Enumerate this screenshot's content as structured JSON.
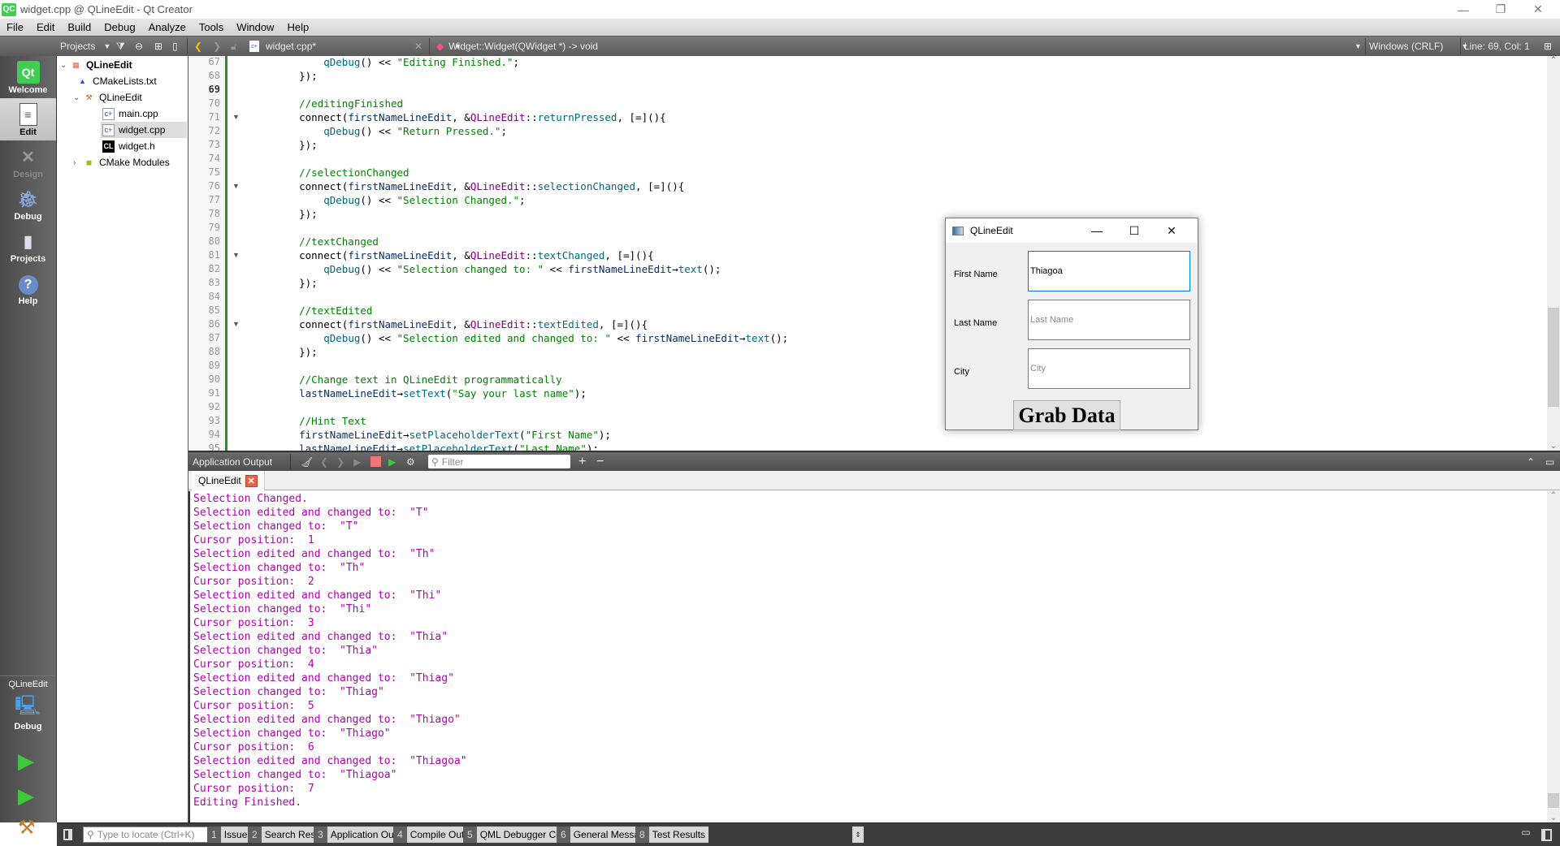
{
  "window": {
    "title": "widget.cpp @ QLineEdit - Qt Creator",
    "app_icon": "QC"
  },
  "menu": [
    "File",
    "Edit",
    "Build",
    "Debug",
    "Analyze",
    "Tools",
    "Window",
    "Help"
  ],
  "toolbar": {
    "projects_label": "Projects",
    "file_tab": "widget.cpp*",
    "symbol": "Widget::Widget(QWidget *) -> void",
    "line_ending": "Windows (CRLF)",
    "cursor_pos": "Line: 69, Col: 1"
  },
  "modes": [
    {
      "label": "Welcome",
      "icon": "qt-logo-icon"
    },
    {
      "label": "Edit",
      "icon": "edit-document-icon"
    },
    {
      "label": "Design",
      "icon": "design-tools-icon"
    },
    {
      "label": "Debug",
      "icon": "bug-icon"
    },
    {
      "label": "Projects",
      "icon": "folder-icon"
    },
    {
      "label": "Help",
      "icon": "help-icon"
    }
  ],
  "kit": {
    "project": "QLineEdit",
    "config": "Debug"
  },
  "tree": [
    {
      "label": "QLineEdit",
      "bold": true
    },
    {
      "label": "CMakeLists.txt"
    },
    {
      "label": "QLineEdit"
    },
    {
      "label": "main.cpp"
    },
    {
      "label": "widget.cpp"
    },
    {
      "label": "widget.h"
    },
    {
      "label": "CMake Modules"
    }
  ],
  "code": [
    {
      "n": "67",
      "t": "        qDebug() << \"Editing Finished.\";"
    },
    {
      "n": "68",
      "t": "    });"
    },
    {
      "n": "69",
      "t": ""
    },
    {
      "n": "70",
      "t": "    //editingFinished"
    },
    {
      "n": "71",
      "t": "    connect(firstNameLineEdit, &QLineEdit::returnPressed, [=](){"
    },
    {
      "n": "72",
      "t": "        qDebug() << \"Return Pressed.\";"
    },
    {
      "n": "73",
      "t": "    });"
    },
    {
      "n": "74",
      "t": ""
    },
    {
      "n": "75",
      "t": "    //selectionChanged"
    },
    {
      "n": "76",
      "t": "    connect(firstNameLineEdit, &QLineEdit::selectionChanged, [=](){"
    },
    {
      "n": "77",
      "t": "        qDebug() << \"Selection Changed.\";"
    },
    {
      "n": "78",
      "t": "    });"
    },
    {
      "n": "79",
      "t": ""
    },
    {
      "n": "80",
      "t": "    //textChanged"
    },
    {
      "n": "81",
      "t": "    connect(firstNameLineEdit, &QLineEdit::textChanged, [=](){"
    },
    {
      "n": "82",
      "t": "        qDebug() << \"Selection changed to: \" << firstNameLineEdit→text();"
    },
    {
      "n": "83",
      "t": "    });"
    },
    {
      "n": "84",
      "t": ""
    },
    {
      "n": "85",
      "t": "    //textEdited"
    },
    {
      "n": "86",
      "t": "    connect(firstNameLineEdit, &QLineEdit::textEdited, [=](){"
    },
    {
      "n": "87",
      "t": "        qDebug() << \"Selection edited and changed to: \" << firstNameLineEdit→text();"
    },
    {
      "n": "88",
      "t": "    });"
    },
    {
      "n": "89",
      "t": ""
    },
    {
      "n": "90",
      "t": "    //Change text in QLineEdit programmatically"
    },
    {
      "n": "91",
      "t": "    lastNameLineEdit→setText(\"Say your last name\");"
    },
    {
      "n": "92",
      "t": ""
    },
    {
      "n": "93",
      "t": "    //Hint Text"
    },
    {
      "n": "94",
      "t": "    firstNameLineEdit→setPlaceholderText(\"First Name\");"
    },
    {
      "n": "95",
      "t": "    lastNameLineEdit→setPlaceholderText(\"Last Name\");"
    }
  ],
  "dialog": {
    "title": "QLineEdit",
    "fields": [
      {
        "label": "First Name",
        "value": "Thiagoa",
        "placeholder": "First Name"
      },
      {
        "label": "Last Name",
        "value": "",
        "placeholder": "Last Name"
      },
      {
        "label": "City",
        "value": "",
        "placeholder": "City"
      }
    ],
    "button": "Grab Data"
  },
  "output_pane": {
    "title": "Application Output",
    "filter_placeholder": "Filter",
    "tab": "QLineEdit",
    "lines": [
      "Selection Changed.",
      "Selection edited and changed to:  \"T\"",
      "Selection changed to:  \"T\"",
      "Cursor position:  1",
      "Selection edited and changed to:  \"Th\"",
      "Selection changed to:  \"Th\"",
      "Cursor position:  2",
      "Selection edited and changed to:  \"Thi\"",
      "Selection changed to:  \"Thi\"",
      "Cursor position:  3",
      "Selection edited and changed to:  \"Thia\"",
      "Selection changed to:  \"Thia\"",
      "Cursor position:  4",
      "Selection edited and changed to:  \"Thiag\"",
      "Selection changed to:  \"Thiag\"",
      "Cursor position:  5",
      "Selection edited and changed to:  \"Thiago\"",
      "Selection changed to:  \"Thiago\"",
      "Cursor position:  6",
      "Selection edited and changed to:  \"Thiagoa\"",
      "Selection changed to:  \"Thiagoa\"",
      "Cursor position:  7",
      "Editing Finished."
    ]
  },
  "statusbar": {
    "locate_placeholder": "Type to locate (Ctrl+K)",
    "panes": [
      {
        "n": "1",
        "label": "Issues"
      },
      {
        "n": "2",
        "label": "Search Results"
      },
      {
        "n": "3",
        "label": "Application Output"
      },
      {
        "n": "4",
        "label": "Compile Output"
      },
      {
        "n": "5",
        "label": "QML Debugger Console"
      },
      {
        "n": "6",
        "label": "General Messages"
      },
      {
        "n": "8",
        "label": "Test Results"
      }
    ]
  }
}
